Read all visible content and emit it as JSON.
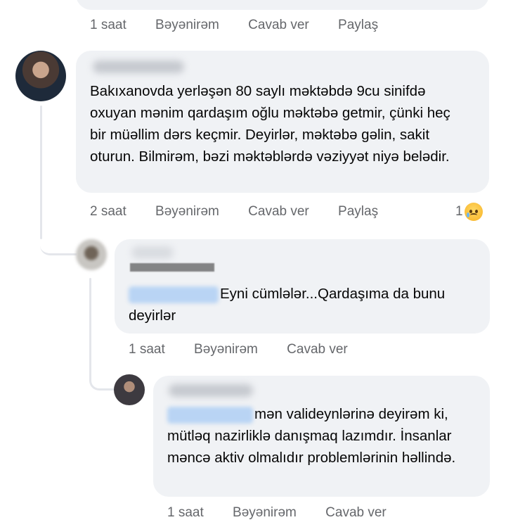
{
  "top_comment": {
    "actions": {
      "time": "1 saat",
      "like": "Bəyənirəm",
      "reply": "Cavab ver",
      "share": "Paylaş"
    }
  },
  "main_comment": {
    "text": "Bakıxanovda yerləşən 80 saylı məktəbdə 9cu sinifdə oxuyan  mənim qardaşım oğlu məktəbə getmir, çünki heç bir müəllim dərs keçmir. Deyirlər, məktəbə gəlin, sakit oturun. Bilmirəm, bəzi məktəblərdə vəziyyət niyə belədir.",
    "actions": {
      "time": "2 saat",
      "like": "Bəyənirəm",
      "reply": "Cavab ver",
      "share": "Paylaş"
    },
    "reaction": {
      "count": "1",
      "icon": "sad-emoji-icon"
    }
  },
  "reply_1": {
    "text": "Eyni cümlələr...Qardaşıma da bunu deyirlər",
    "actions": {
      "time": "1 saat",
      "like": "Bəyənirəm",
      "reply": "Cavab ver"
    }
  },
  "reply_2": {
    "text": "mən valideynlərinə deyirəm ki, mütləq nazirliklə danışmaq lazımdır. İnsanlar məncə aktiv olmalıdır problemlərinin həllində.",
    "actions": {
      "time": "1 saat",
      "like": "Bəyənirəm",
      "reply": "Cavab ver"
    }
  },
  "colors": {
    "bubble": "#f0f2f5",
    "meta_text": "#65676b",
    "mention": "#b9d4f4"
  }
}
